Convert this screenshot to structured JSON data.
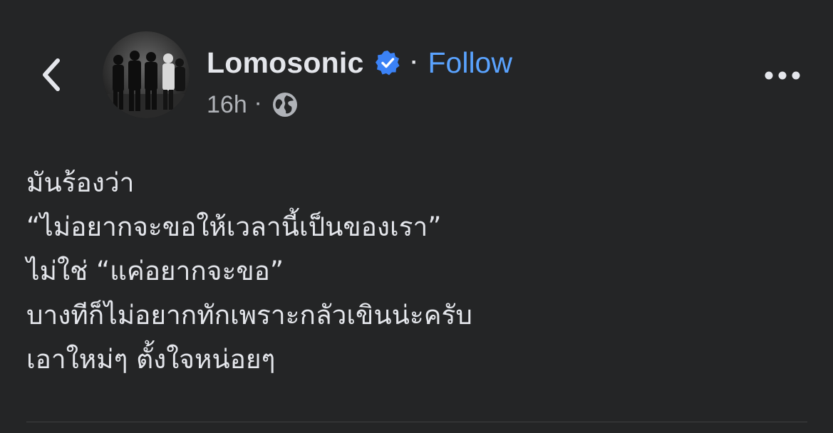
{
  "header": {
    "back_icon": "chevron-left-icon",
    "author_name": "Lomosonic",
    "verified_icon": "verified-badge-icon",
    "separator": "·",
    "follow_label": "Follow",
    "timestamp": "16h",
    "meta_separator": "·",
    "privacy_icon": "globe-icon",
    "more_icon": "more-horizontal-icon"
  },
  "post": {
    "lines": [
      "มันร้องว่า",
      "“ไม่อยากจะขอให้เวลานี้เป็นของเรา”",
      "ไม่ใช่ “แค่อยากจะขอ”",
      "บางทีก็ไม่อยากทักเพราะกลัวเขินน่ะครับ",
      "เอาใหม่ๆ ตั้งใจหน่อยๆ"
    ]
  },
  "colors": {
    "background": "#242526",
    "primary_text": "#e4e6eb",
    "secondary_text": "#b0b3b8",
    "link": "#5aa3ff",
    "verified": "#3b82f6"
  }
}
